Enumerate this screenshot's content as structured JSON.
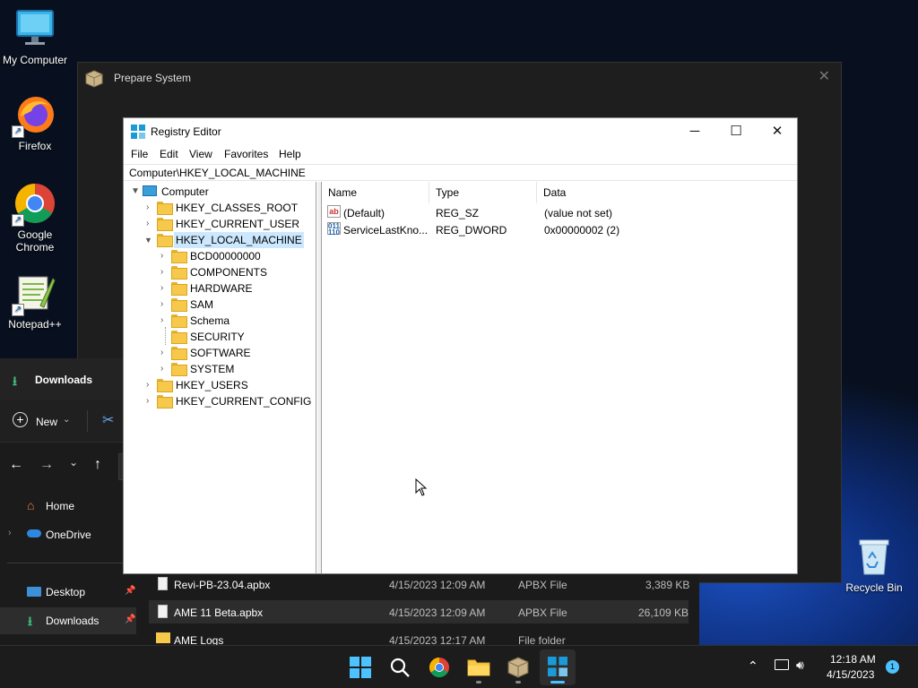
{
  "desktop": {
    "icons": [
      {
        "label": "My Computer",
        "icon": "monitor-icon"
      },
      {
        "label": "Firefox",
        "icon": "firefox-icon"
      },
      {
        "label": "Google Chrome",
        "icon": "chrome-icon"
      },
      {
        "label": "Notepad++",
        "icon": "notepad-plus-plus-icon"
      },
      {
        "label": "Recycle Bin",
        "icon": "recycle-bin-icon"
      }
    ]
  },
  "prepare_window": {
    "title": "Prepare System",
    "close_glyph": "✕"
  },
  "explorer": {
    "tab_title": "Downloads",
    "new_label": "New",
    "sidebar": [
      {
        "label": "Home",
        "icon": "home-icon"
      },
      {
        "label": "OneDrive",
        "icon": "cloud-icon"
      },
      {
        "label": "Desktop",
        "icon": "desktop-icon"
      },
      {
        "label": "Downloads",
        "icon": "download-icon"
      }
    ],
    "files": [
      {
        "name": "Revi-PB-23.04.apbx",
        "date": "4/15/2023 12:09 AM",
        "type": "APBX File",
        "size": "3,389 KB"
      },
      {
        "name": "AME 11 Beta.apbx",
        "date": "4/15/2023 12:09 AM",
        "type": "APBX File",
        "size": "26,109 KB"
      },
      {
        "name": "AME Logs",
        "date": "4/15/2023 12:17 AM",
        "type": "File folder",
        "size": ""
      }
    ]
  },
  "regedit": {
    "title": "Registry Editor",
    "menu": [
      "File",
      "Edit",
      "View",
      "Favorites",
      "Help"
    ],
    "address": "Computer\\HKEY_LOCAL_MACHINE",
    "tree": {
      "root": "Computer",
      "hives": [
        "HKEY_CLASSES_ROOT",
        "HKEY_CURRENT_USER",
        "HKEY_LOCAL_MACHINE"
      ],
      "hklm_children": [
        "BCD00000000",
        "COMPONENTS",
        "HARDWARE",
        "SAM",
        "Schema",
        "SECURITY",
        "SOFTWARE",
        "SYSTEM"
      ],
      "after": [
        "HKEY_USERS",
        "HKEY_CURRENT_CONFIG"
      ]
    },
    "columns": {
      "name": "Name",
      "type": "Type",
      "data": "Data"
    },
    "values": [
      {
        "name": "(Default)",
        "type": "REG_SZ",
        "data": "(value not set)",
        "icon": "string-value-icon"
      },
      {
        "name": "ServiceLastKno...",
        "type": "REG_DWORD",
        "data": "0x00000002 (2)",
        "icon": "dword-value-icon"
      }
    ]
  },
  "taskbar": {
    "time": "12:18 AM",
    "date": "4/15/2023",
    "notification_count": "1"
  }
}
